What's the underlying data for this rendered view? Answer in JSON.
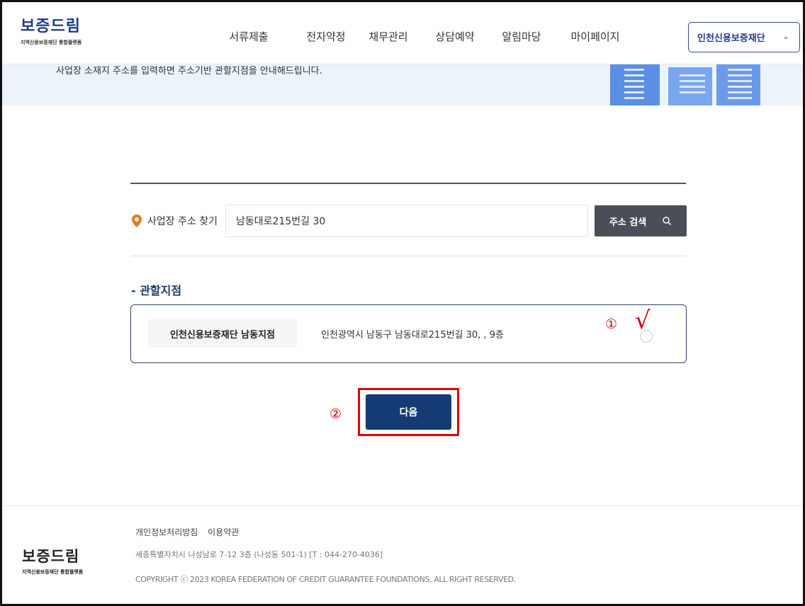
{
  "header": {
    "logo": "보증드림",
    "logo_sub": "지역신용보증재단 통합플랫폼",
    "nav": [
      "서류제출",
      "전자약정",
      "채무관리",
      "상담예약",
      "알림마당",
      "마이페이지"
    ],
    "org_select": "인천신용보증재단"
  },
  "banner": {
    "text": "사업장 소재지 주소를 입력하면 주소기반 관할지점을 안내해드립니다."
  },
  "search": {
    "label": "사업장 주소 찾기",
    "value": "남동대로215번길 30",
    "button": "주소 검색"
  },
  "branch_section": {
    "title": "- 관할지점",
    "branch_name": "인천신용보증재단 남동지점",
    "branch_address": "인천광역시 남동구 남동대로215번길 30, , 9층"
  },
  "annotations": {
    "mark1": "①",
    "mark2": "②",
    "check": "√"
  },
  "next_button": "다음",
  "footer": {
    "logo": "보증드림",
    "logo_sub": "지역신용보증재단 통합플랫폼",
    "links": [
      "개인정보처리방침",
      "이용약관"
    ],
    "address": "세종특별자치시 나성남로 7-12 3층 (나성동 501-1) [T : 044-270-4036]",
    "copyright": "COPYRIGHT ⓒ 2023 KOREA FEDERATION OF CREDIT GUARANTEE FOUNDATIONS. ALL RIGHT RESERVED."
  },
  "colors": {
    "brand": "#1e3a8a",
    "primary_button": "#143b73",
    "search_button": "#4a4f57",
    "annotation_red": "#d10000",
    "banner_bg": "#ecf3fb"
  }
}
